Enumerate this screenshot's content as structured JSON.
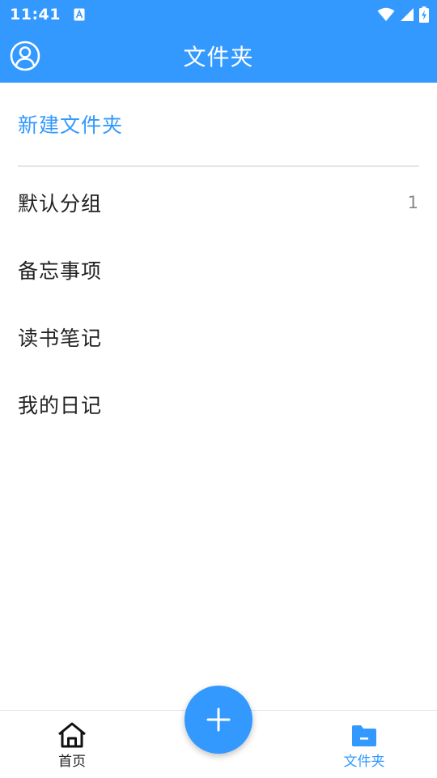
{
  "status_bar": {
    "time": "11:41",
    "notification_icon": "a-letter-icon",
    "icons": [
      "wifi-icon",
      "signal-icon",
      "battery-charging-icon"
    ]
  },
  "app_bar": {
    "title": "文件夹",
    "left_icon": "profile-icon"
  },
  "new_folder": {
    "label": "新建文件夹"
  },
  "folders": [
    {
      "name": "默认分组",
      "count": "1"
    },
    {
      "name": "备忘事项",
      "count": ""
    },
    {
      "name": "读书笔记",
      "count": ""
    },
    {
      "name": "我的日记",
      "count": ""
    }
  ],
  "bottom_nav": {
    "home": {
      "label": "首页",
      "icon": "home-icon",
      "active": false
    },
    "folder": {
      "label": "文件夹",
      "icon": "folder-icon",
      "active": true
    }
  },
  "fab": {
    "icon": "plus-icon"
  },
  "colors": {
    "primary": "#3399ff",
    "text": "#222222",
    "secondary_text": "#888888",
    "divider": "#e6e6e6"
  }
}
